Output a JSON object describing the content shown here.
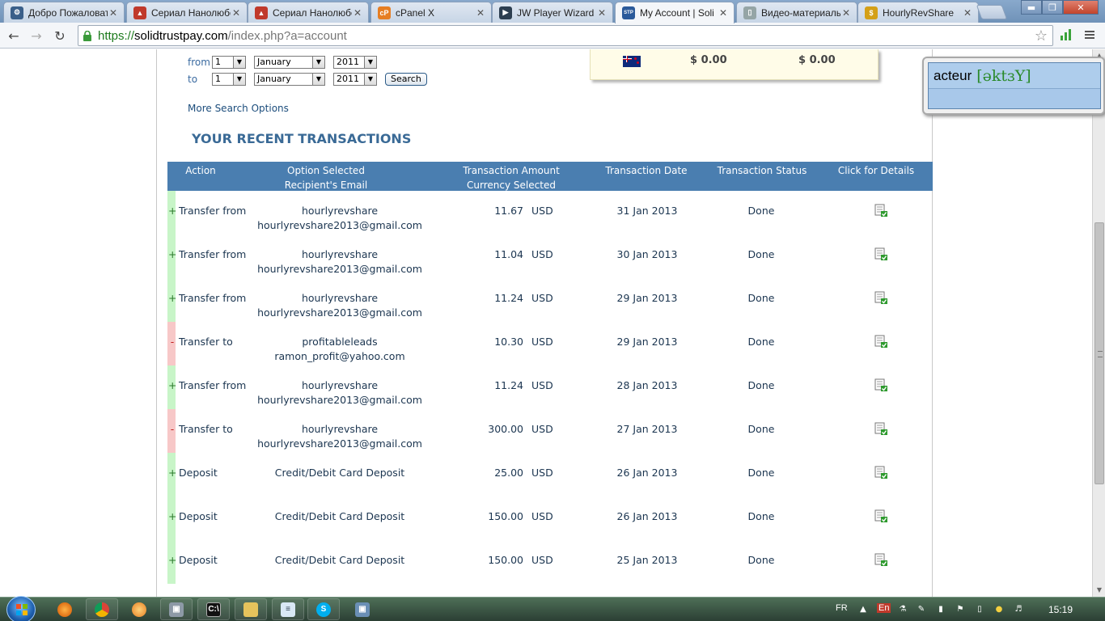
{
  "browser": {
    "tabs": [
      {
        "title": "Добро Пожаловать",
        "favicon": "gear-icon",
        "color": "#3a5f8a",
        "glyph": "⚙"
      },
      {
        "title": "Сериал Нанолюбой",
        "favicon": "boot-icon",
        "color": "#c0392b",
        "glyph": "▲"
      },
      {
        "title": "Сериал Нанолюбой",
        "favicon": "boot-icon",
        "color": "#c0392b",
        "glyph": "▲"
      },
      {
        "title": "cPanel X",
        "favicon": "cpanel-icon",
        "color": "#e67e22",
        "glyph": "cP"
      },
      {
        "title": "JW Player Wizard",
        "favicon": "jwplayer-icon",
        "color": "#2c3e50",
        "glyph": "▶"
      },
      {
        "title": "My Account | Soli",
        "favicon": "stp-icon",
        "color": "#2b5a9a",
        "glyph": "STP"
      },
      {
        "title": "Видео-материалы",
        "favicon": "document-icon",
        "color": "#95a5a6",
        "glyph": "▯"
      },
      {
        "title": "HourlyRevShare",
        "favicon": "coin-icon",
        "color": "#d4a017",
        "glyph": "$"
      }
    ],
    "active_tab": 5,
    "url": {
      "scheme": "https://",
      "host": "solidtrustpay.com",
      "path": "/index.php?a=account"
    }
  },
  "search_form": {
    "from_label": "from",
    "to_label": "to",
    "from": {
      "day": "1",
      "month": "January",
      "year": "2011"
    },
    "to": {
      "day": "1",
      "month": "January",
      "year": "2011"
    },
    "search_button": "Search",
    "more_options": "More Search Options"
  },
  "balance": {
    "value1": "$ 0.00",
    "value2": "$ 0.00"
  },
  "section_title": "YOUR RECENT TRANSACTIONS",
  "table": {
    "headers": {
      "action": "Action",
      "option_1": "Option Selected",
      "option_2": "Recipient's Email",
      "amount_1": "Transaction Amount",
      "amount_2": "Currency Selected",
      "date": "Transaction Date",
      "status": "Transaction Status",
      "details": "Click for Details"
    },
    "rows": [
      {
        "sign": "+",
        "type": "plus",
        "action": "Transfer from",
        "name": "hourlyrevshare",
        "email": "hourlyrevshare2013@gmail.com",
        "amount": "11.67",
        "currency": "USD",
        "date": "31 Jan 2013",
        "status": "Done"
      },
      {
        "sign": "+",
        "type": "plus",
        "action": "Transfer from",
        "name": "hourlyrevshare",
        "email": "hourlyrevshare2013@gmail.com",
        "amount": "11.04",
        "currency": "USD",
        "date": "30 Jan 2013",
        "status": "Done"
      },
      {
        "sign": "+",
        "type": "plus",
        "action": "Transfer from",
        "name": "hourlyrevshare",
        "email": "hourlyrevshare2013@gmail.com",
        "amount": "11.24",
        "currency": "USD",
        "date": "29 Jan 2013",
        "status": "Done"
      },
      {
        "sign": "-",
        "type": "minus",
        "action": "Transfer to",
        "name": "profitableleads",
        "email": "ramon_profit@yahoo.com",
        "amount": "10.30",
        "currency": "USD",
        "date": "29 Jan 2013",
        "status": "Done"
      },
      {
        "sign": "+",
        "type": "plus",
        "action": "Transfer from",
        "name": "hourlyrevshare",
        "email": "hourlyrevshare2013@gmail.com",
        "amount": "11.24",
        "currency": "USD",
        "date": "28 Jan 2013",
        "status": "Done"
      },
      {
        "sign": "-",
        "type": "minus",
        "action": "Transfer to",
        "name": "hourlyrevshare",
        "email": "hourlyrevshare2013@gmail.com",
        "amount": "300.00",
        "currency": "USD",
        "date": "27 Jan 2013",
        "status": "Done"
      },
      {
        "sign": "+",
        "type": "plus",
        "action": "Deposit",
        "name": "Credit/Debit Card Deposit",
        "email": "",
        "amount": "25.00",
        "currency": "USD",
        "date": "26 Jan 2013",
        "status": "Done"
      },
      {
        "sign": "+",
        "type": "plus",
        "action": "Deposit",
        "name": "Credit/Debit Card Deposit",
        "email": "",
        "amount": "150.00",
        "currency": "USD",
        "date": "26 Jan 2013",
        "status": "Done"
      },
      {
        "sign": "+",
        "type": "plus",
        "action": "Deposit",
        "name": "Credit/Debit Card Deposit",
        "email": "",
        "amount": "150.00",
        "currency": "USD",
        "date": "25 Jan 2013",
        "status": "Done"
      }
    ]
  },
  "dictionary_popup": {
    "word": "acteur",
    "phonetic": "[əktɜY]"
  },
  "taskbar": {
    "language": "FR",
    "keyboard": "En",
    "clock": "15:19"
  },
  "colors": {
    "header_bg": "#4a7eb0",
    "plus_bar": "#c8f5c8",
    "minus_bar": "#f7c8c8",
    "title_blue": "#3a6a96"
  }
}
